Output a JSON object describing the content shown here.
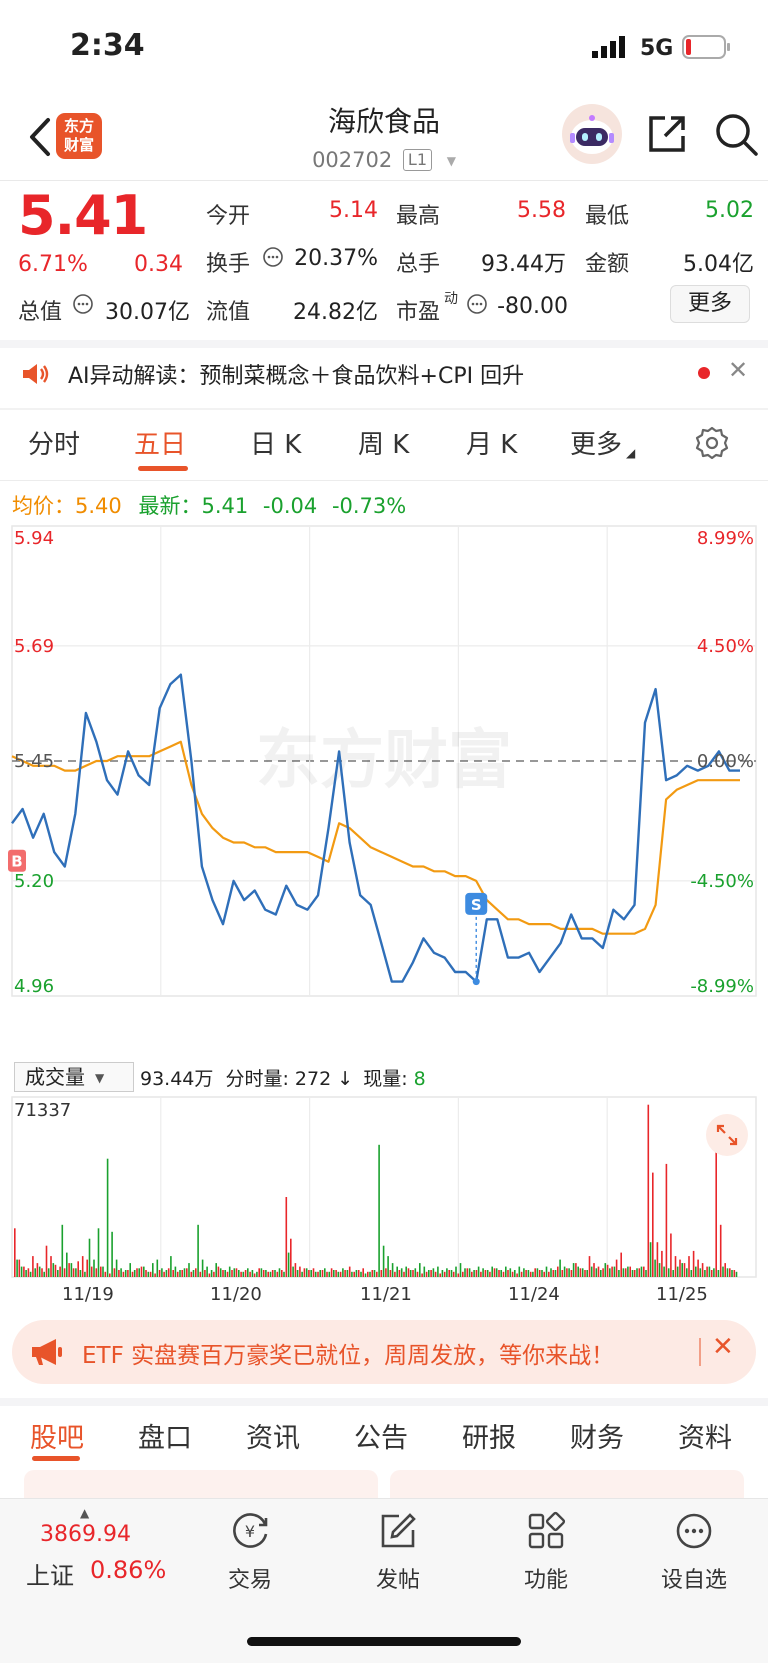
{
  "status_bar": {
    "time": "2:34",
    "network": "5G"
  },
  "header": {
    "logo_text_line1": "东方",
    "logo_text_line2": "财富",
    "stock_name": "海欣食品",
    "stock_code": "002702",
    "level": "L1"
  },
  "quote": {
    "price": "5.41",
    "change_pct": "6.71%",
    "change_amt": "0.34",
    "open_label": "今开",
    "open": "5.14",
    "high_label": "最高",
    "high": "5.58",
    "low_label": "最低",
    "low": "5.02",
    "turnover_label": "换手",
    "turnover": "20.37%",
    "volume_label": "总手",
    "volume": "93.44万",
    "amount_label": "金额",
    "amount": "5.04亿",
    "mktcap_label": "总值",
    "mktcap": "30.07亿",
    "float_label": "流值",
    "float_cap": "24.82亿",
    "pe_label": "市盈",
    "pe_sup": "动",
    "pe": "-80.00",
    "more_label": "更多"
  },
  "ai_banner": {
    "text": "AI异动解读：预制菜概念＋食品饮料+CPI 回升"
  },
  "tabs": [
    "分时",
    "五日",
    "日 K",
    "周 K",
    "月 K",
    "更多"
  ],
  "active_tab": "五日",
  "avg_line": {
    "avg_label": "均价：",
    "avg": "5.40",
    "latest_label": "最新：",
    "latest": "5.41",
    "chg": "-0.04",
    "pct": "-0.73%"
  },
  "chart_data": {
    "type": "line",
    "title": "",
    "watermark": "东方财富",
    "y_left_ticks": [
      "5.94",
      "5.69",
      "5.45",
      "5.20",
      "4.96"
    ],
    "y_right_ticks": [
      "8.99%",
      "4.50%",
      "0.00%",
      "-4.50%",
      "-8.99%"
    ],
    "ylim": [
      4.96,
      5.94
    ],
    "baseline": 5.45,
    "x_categories": [
      "11/19",
      "11/20",
      "11/21",
      "11/24",
      "11/25"
    ],
    "markers": [
      {
        "label": "B"
      },
      {
        "label": "S"
      }
    ],
    "series": [
      {
        "values": [
          5.32,
          5.35,
          5.29,
          5.34,
          5.26,
          5.23,
          5.34,
          5.55,
          5.49,
          5.41,
          5.38,
          5.47,
          5.42,
          5.4,
          5.56,
          5.61,
          5.63,
          5.45,
          5.23,
          5.16,
          5.11,
          5.2,
          5.16,
          5.18,
          5.14,
          5.13,
          5.19,
          5.15,
          5.14,
          5.17,
          5.31,
          5.47,
          5.28,
          5.17,
          5.15,
          5.07,
          4.99,
          4.99,
          5.03,
          5.08,
          5.05,
          5.04,
          5.01,
          5.01,
          4.99,
          5.12,
          5.12,
          5.04,
          5.04,
          5.05,
          5.01,
          5.04,
          5.07,
          5.13,
          5.08,
          5.08,
          5.06,
          5.14,
          5.12,
          5.15,
          5.53,
          5.6,
          5.41,
          5.42,
          5.44,
          5.43,
          5.44,
          5.47,
          5.43,
          5.43
        ]
      },
      {
        "values": [
          5.46,
          5.45,
          5.44,
          5.44,
          5.44,
          5.43,
          5.43,
          5.44,
          5.45,
          5.45,
          5.46,
          5.46,
          5.46,
          5.46,
          5.47,
          5.48,
          5.49,
          5.4,
          5.34,
          5.31,
          5.29,
          5.28,
          5.28,
          5.27,
          5.27,
          5.26,
          5.26,
          5.26,
          5.26,
          5.25,
          5.24,
          5.32,
          5.31,
          5.29,
          5.27,
          5.26,
          5.25,
          5.24,
          5.23,
          5.23,
          5.22,
          5.22,
          5.21,
          5.21,
          5.2,
          5.16,
          5.14,
          5.12,
          5.12,
          5.11,
          5.11,
          5.11,
          5.1,
          5.1,
          5.1,
          5.1,
          5.09,
          5.09,
          5.09,
          5.09,
          5.1,
          5.15,
          5.37,
          5.39,
          5.4,
          5.41,
          5.41,
          5.41,
          5.41,
          5.41
        ]
      }
    ],
    "colors": {
      "price": "#2f6fb9",
      "avg": "#f29a12",
      "up": "#e8262a",
      "down": "#1aa12e"
    }
  },
  "volume": {
    "dropdown_label": "成交量",
    "total": "93.44万",
    "minute_label": "分时量:",
    "minute": "272",
    "arrow": "↓",
    "current_label": "现量:",
    "current": "8",
    "max": "71337",
    "bars_red": [
      0.28,
      0.1,
      0.06,
      0.05,
      0.12,
      0.08,
      0.05,
      0.18,
      0.12,
      0.07,
      0.06,
      0.05,
      0.08,
      0.05,
      0.09,
      0.12,
      0.1,
      0.06,
      0.05,
      0.06,
      0.03,
      0.02,
      0.05,
      0.04,
      0.03,
      0.04,
      0.03,
      0.05,
      0.06,
      0.04,
      0.03,
      0.02,
      0.04,
      0.03,
      0.05,
      0.04,
      0.03,
      0.04,
      0.05,
      0.03,
      0.05,
      0.03,
      0.04,
      0.02,
      0.03,
      0.06,
      0.04,
      0.03,
      0.04,
      0.05,
      0.03,
      0.04,
      0.03,
      0.02,
      0.05,
      0.04,
      0.03,
      0.04,
      0.03,
      0.04,
      0.46,
      0.22,
      0.08,
      0.06,
      0.05,
      0.04,
      0.05,
      0.03,
      0.04,
      0.03,
      0.05,
      0.04,
      0.03,
      0.04,
      0.06,
      0.03,
      0.04,
      0.05,
      0.03,
      0.04,
      0.03,
      0.04,
      0.05,
      0.04,
      0.03,
      0.04,
      0.03,
      0.05,
      0.04,
      0.03,
      0.02,
      0.03,
      0.04,
      0.03,
      0.02,
      0.03,
      0.04,
      0.03,
      0.02,
      0.03,
      0.05,
      0.03,
      0.04,
      0.03,
      0.04,
      0.03,
      0.05,
      0.04,
      0.03,
      0.04,
      0.03,
      0.02,
      0.03,
      0.04,
      0.03,
      0.05,
      0.04,
      0.03,
      0.03,
      0.04,
      0.06,
      0.04,
      0.05,
      0.04,
      0.08,
      0.05,
      0.04,
      0.12,
      0.08,
      0.06,
      0.05,
      0.07,
      0.06,
      0.1,
      0.14,
      0.05,
      0.06,
      0.04,
      0.05,
      0.06,
      0.99,
      0.6,
      0.2,
      0.15,
      0.65,
      0.25,
      0.12,
      0.1,
      0.08,
      0.12,
      0.15,
      0.1,
      0.08,
      0.06,
      0.04,
      0.76,
      0.3,
      0.08,
      0.05,
      0.04
    ],
    "bars_green": [
      0.1,
      0.06,
      0.04,
      0.03,
      0.05,
      0.06,
      0.03,
      0.05,
      0.08,
      0.04,
      0.3,
      0.14,
      0.08,
      0.05,
      0.04,
      0.03,
      0.22,
      0.1,
      0.28,
      0.06,
      0.68,
      0.26,
      0.1,
      0.05,
      0.04,
      0.08,
      0.04,
      0.05,
      0.06,
      0.03,
      0.08,
      0.1,
      0.05,
      0.04,
      0.12,
      0.06,
      0.04,
      0.05,
      0.08,
      0.04,
      0.3,
      0.1,
      0.06,
      0.04,
      0.08,
      0.05,
      0.04,
      0.06,
      0.05,
      0.04,
      0.03,
      0.05,
      0.04,
      0.03,
      0.05,
      0.04,
      0.03,
      0.04,
      0.05,
      0.03,
      0.14,
      0.06,
      0.04,
      0.03,
      0.05,
      0.04,
      0.03,
      0.04,
      0.05,
      0.03,
      0.04,
      0.03,
      0.05,
      0.04,
      0.03,
      0.04,
      0.03,
      0.02,
      0.03,
      0.04,
      0.76,
      0.18,
      0.12,
      0.08,
      0.06,
      0.05,
      0.06,
      0.04,
      0.05,
      0.08,
      0.06,
      0.04,
      0.05,
      0.06,
      0.04,
      0.05,
      0.04,
      0.06,
      0.08,
      0.05,
      0.05,
      0.04,
      0.06,
      0.05,
      0.04,
      0.06,
      0.05,
      0.04,
      0.06,
      0.05,
      0.04,
      0.06,
      0.05,
      0.04,
      0.03,
      0.05,
      0.04,
      0.06,
      0.05,
      0.04,
      0.1,
      0.06,
      0.05,
      0.08,
      0.06,
      0.05,
      0.04,
      0.06,
      0.05,
      0.04,
      0.08,
      0.05,
      0.06,
      0.04,
      0.05,
      0.06,
      0.04,
      0.05,
      0.06,
      0.04,
      0.2,
      0.1,
      0.08,
      0.06,
      0.05,
      0.04,
      0.06,
      0.08,
      0.05,
      0.04,
      0.06,
      0.05,
      0.04,
      0.06,
      0.05,
      0.04,
      0.06,
      0.05,
      0.04,
      0.03
    ]
  },
  "etf_banner": {
    "text": "ETF 实盘赛百万豪奖已就位，周周发放，等你来战！"
  },
  "bottom_tabs": [
    "股吧",
    "盘口",
    "资讯",
    "公告",
    "研报",
    "财务",
    "资料"
  ],
  "bottom_nav": {
    "index_value": "3869.94",
    "index_name": "上证",
    "index_pct": "0.86%",
    "items": [
      {
        "label": "交易",
        "icon": "trade-icon"
      },
      {
        "label": "发帖",
        "icon": "post-icon"
      },
      {
        "label": "功能",
        "icon": "grid-icon"
      },
      {
        "label": "设自选",
        "icon": "more-dots-icon"
      }
    ]
  }
}
